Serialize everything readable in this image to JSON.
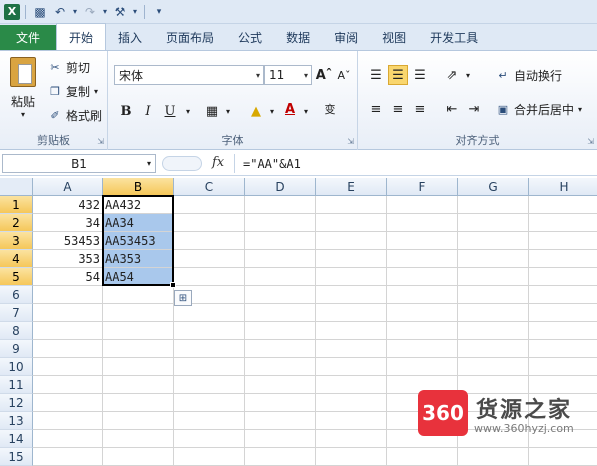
{
  "quick_access": {
    "icons": [
      "excel-icon",
      "save-icon",
      "undo-icon",
      "redo-icon",
      "customize-icon"
    ]
  },
  "tabs": [
    "文件",
    "开始",
    "插入",
    "页面布局",
    "公式",
    "数据",
    "审阅",
    "视图",
    "开发工具"
  ],
  "ribbon": {
    "clipboard": {
      "paste": "粘贴",
      "cut": "剪切",
      "copy": "复制",
      "format_painter": "格式刷",
      "label": "剪贴板"
    },
    "font": {
      "font_name": "宋体",
      "font_size": "11",
      "bold": "B",
      "italic": "I",
      "underline": "U",
      "label": "字体"
    },
    "alignment": {
      "wrap_text": "自动换行",
      "merge_center": "合并后居中",
      "label": "对齐方式"
    }
  },
  "formula_bar": {
    "name_box": "B1",
    "fx": "fx",
    "formula": "=\"AA\"&A1"
  },
  "columns": [
    "A",
    "B",
    "C",
    "D",
    "E",
    "F",
    "G",
    "H"
  ],
  "rows": [
    "1",
    "2",
    "3",
    "4",
    "5",
    "6",
    "7",
    "8",
    "9",
    "10",
    "11",
    "12",
    "13",
    "14",
    "15"
  ],
  "cells": {
    "A": [
      "432",
      "34",
      "53453",
      "353",
      "54"
    ],
    "B": [
      "AA432",
      "AA34",
      "AA53453",
      "AA353",
      "AA54"
    ]
  },
  "watermark": {
    "badge": "360",
    "brand": "货源之家",
    "url": "www.360hyzj.com"
  }
}
